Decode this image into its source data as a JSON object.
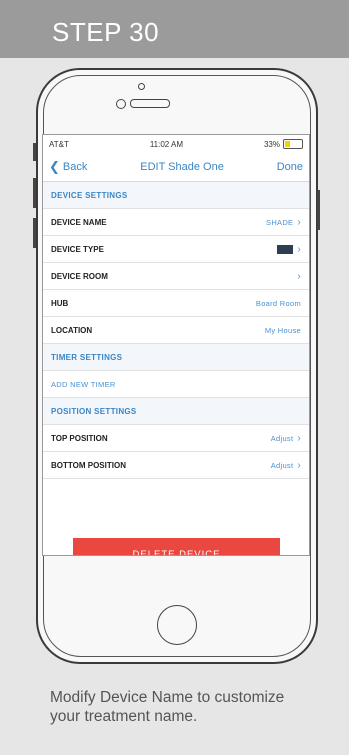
{
  "header": {
    "title": "STEP 30"
  },
  "status_bar": {
    "carrier": "AT&T",
    "time": "11:02 AM",
    "battery": "33%"
  },
  "nav": {
    "back_label": "Back",
    "title": "EDIT Shade One",
    "done_label": "Done"
  },
  "sections": {
    "device_settings": "DEVICE SETTINGS",
    "timer_settings": "TIMER SETTINGS",
    "position_settings": "POSITION SETTINGS"
  },
  "rows": {
    "device_name": {
      "label": "DEVICE NAME",
      "value": "SHADE"
    },
    "device_type": {
      "label": "DEVICE TYPE"
    },
    "device_room": {
      "label": "DEVICE ROOM"
    },
    "hub": {
      "label": "HUB",
      "value": "Board Room"
    },
    "location": {
      "label": "LOCATION",
      "value": "My House"
    },
    "add_timer": {
      "label": "ADD NEW TIMER"
    },
    "top_position": {
      "label": "TOP POSITION",
      "value": "Adjust"
    },
    "bottom_position": {
      "label": "BOTTOM POSITION",
      "value": "Adjust"
    }
  },
  "delete_button": "DELETE DEVICE",
  "caption": "Modify Device Name to customize your treatment name.",
  "colors": {
    "accent": "#3a86c6",
    "delete": "#e9473f",
    "header_bg": "#9b9b9b"
  }
}
